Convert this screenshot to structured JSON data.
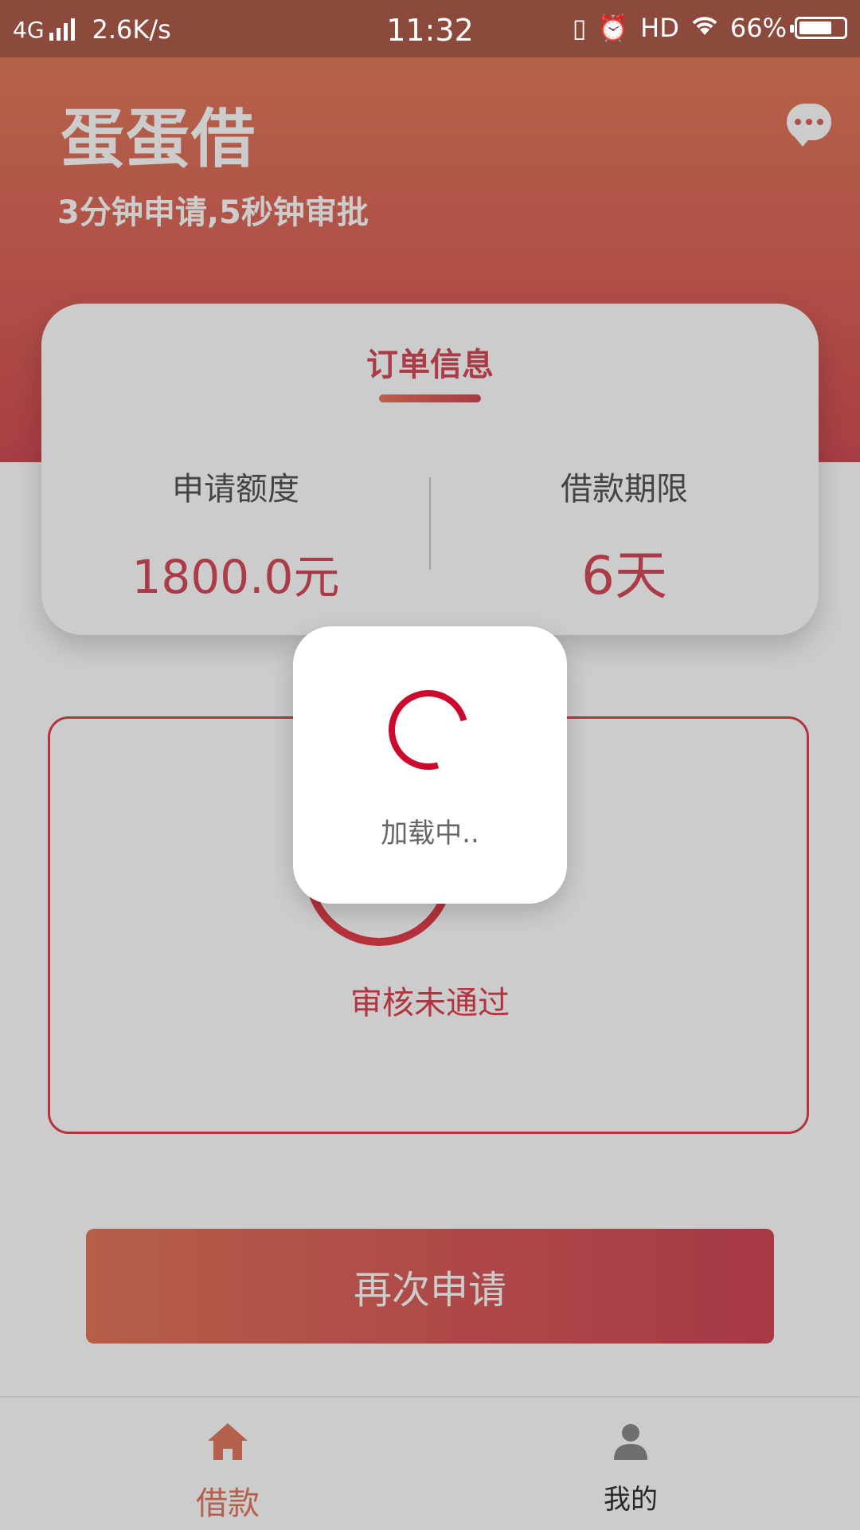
{
  "status_bar": {
    "network": "4G",
    "speed": "2.6K/s",
    "time": "11:32",
    "hd": "HD",
    "battery": "66%",
    "battery_level": 0.66
  },
  "header": {
    "title": "蛋蛋借",
    "subtitle": "3分钟申请,5秒钟审批",
    "chat_icon": "chat-bubble-icon"
  },
  "order_card": {
    "title": "订单信息",
    "amount_label": "申请额度",
    "amount_value": "1800.0元",
    "term_label": "借款期限",
    "term_value": "6天"
  },
  "review": {
    "status_text": "审核未通过"
  },
  "actions": {
    "reapply": "再次申请"
  },
  "loading": {
    "text": "加载中.."
  },
  "bottom_nav": {
    "items": [
      {
        "label": "借款",
        "icon": "home-icon",
        "active": true
      },
      {
        "label": "我的",
        "icon": "user-icon",
        "active": false
      }
    ]
  },
  "colors": {
    "accent": "#d64a59",
    "header_start": "#e27b5d",
    "header_end": "#d14d55",
    "status_bar": "#8c4a3c"
  }
}
